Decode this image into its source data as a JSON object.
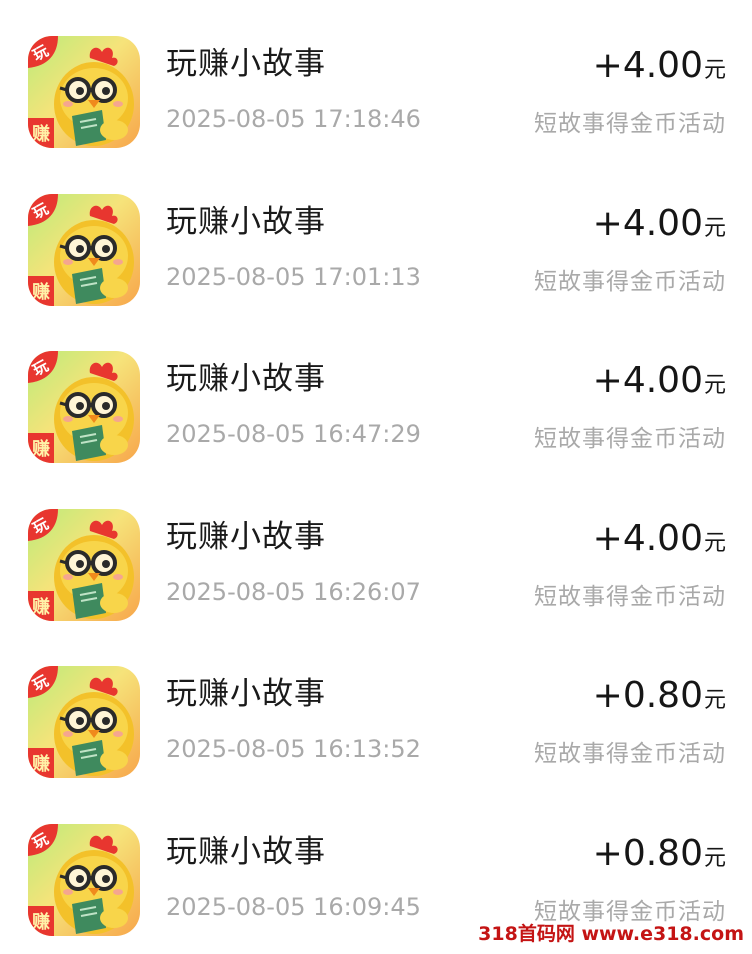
{
  "transactions": [
    {
      "app": "玩赚小故事",
      "time": "2025-08-05 17:18:46",
      "amount": "+4.00",
      "unit": "元",
      "desc": "短故事得金币活动",
      "icon": "chick-reading-book-icon"
    },
    {
      "app": "玩赚小故事",
      "time": "2025-08-05 17:01:13",
      "amount": "+4.00",
      "unit": "元",
      "desc": "短故事得金币活动",
      "icon": "chick-reading-book-icon"
    },
    {
      "app": "玩赚小故事",
      "time": "2025-08-05 16:47:29",
      "amount": "+4.00",
      "unit": "元",
      "desc": "短故事得金币活动",
      "icon": "chick-reading-book-icon"
    },
    {
      "app": "玩赚小故事",
      "time": "2025-08-05 16:26:07",
      "amount": "+4.00",
      "unit": "元",
      "desc": "短故事得金币活动",
      "icon": "chick-reading-book-icon"
    },
    {
      "app": "玩赚小故事",
      "time": "2025-08-05 16:13:52",
      "amount": "+0.80",
      "unit": "元",
      "desc": "短故事得金币活动",
      "icon": "chick-reading-book-icon"
    },
    {
      "app": "玩赚小故事",
      "time": "2025-08-05 16:09:45",
      "amount": "+0.80",
      "unit": "元",
      "desc": "短故事得金币活动",
      "icon": "chick-reading-book-icon"
    }
  ],
  "icon_badge": {
    "top": "玩",
    "bottom": "赚"
  },
  "watermark": "318首码网 www.e318.com",
  "colors": {
    "badge_red": "#e8362f",
    "gold": "#f3b21f",
    "book_green": "#3f8a5e",
    "watermark_red": "#c41414"
  }
}
